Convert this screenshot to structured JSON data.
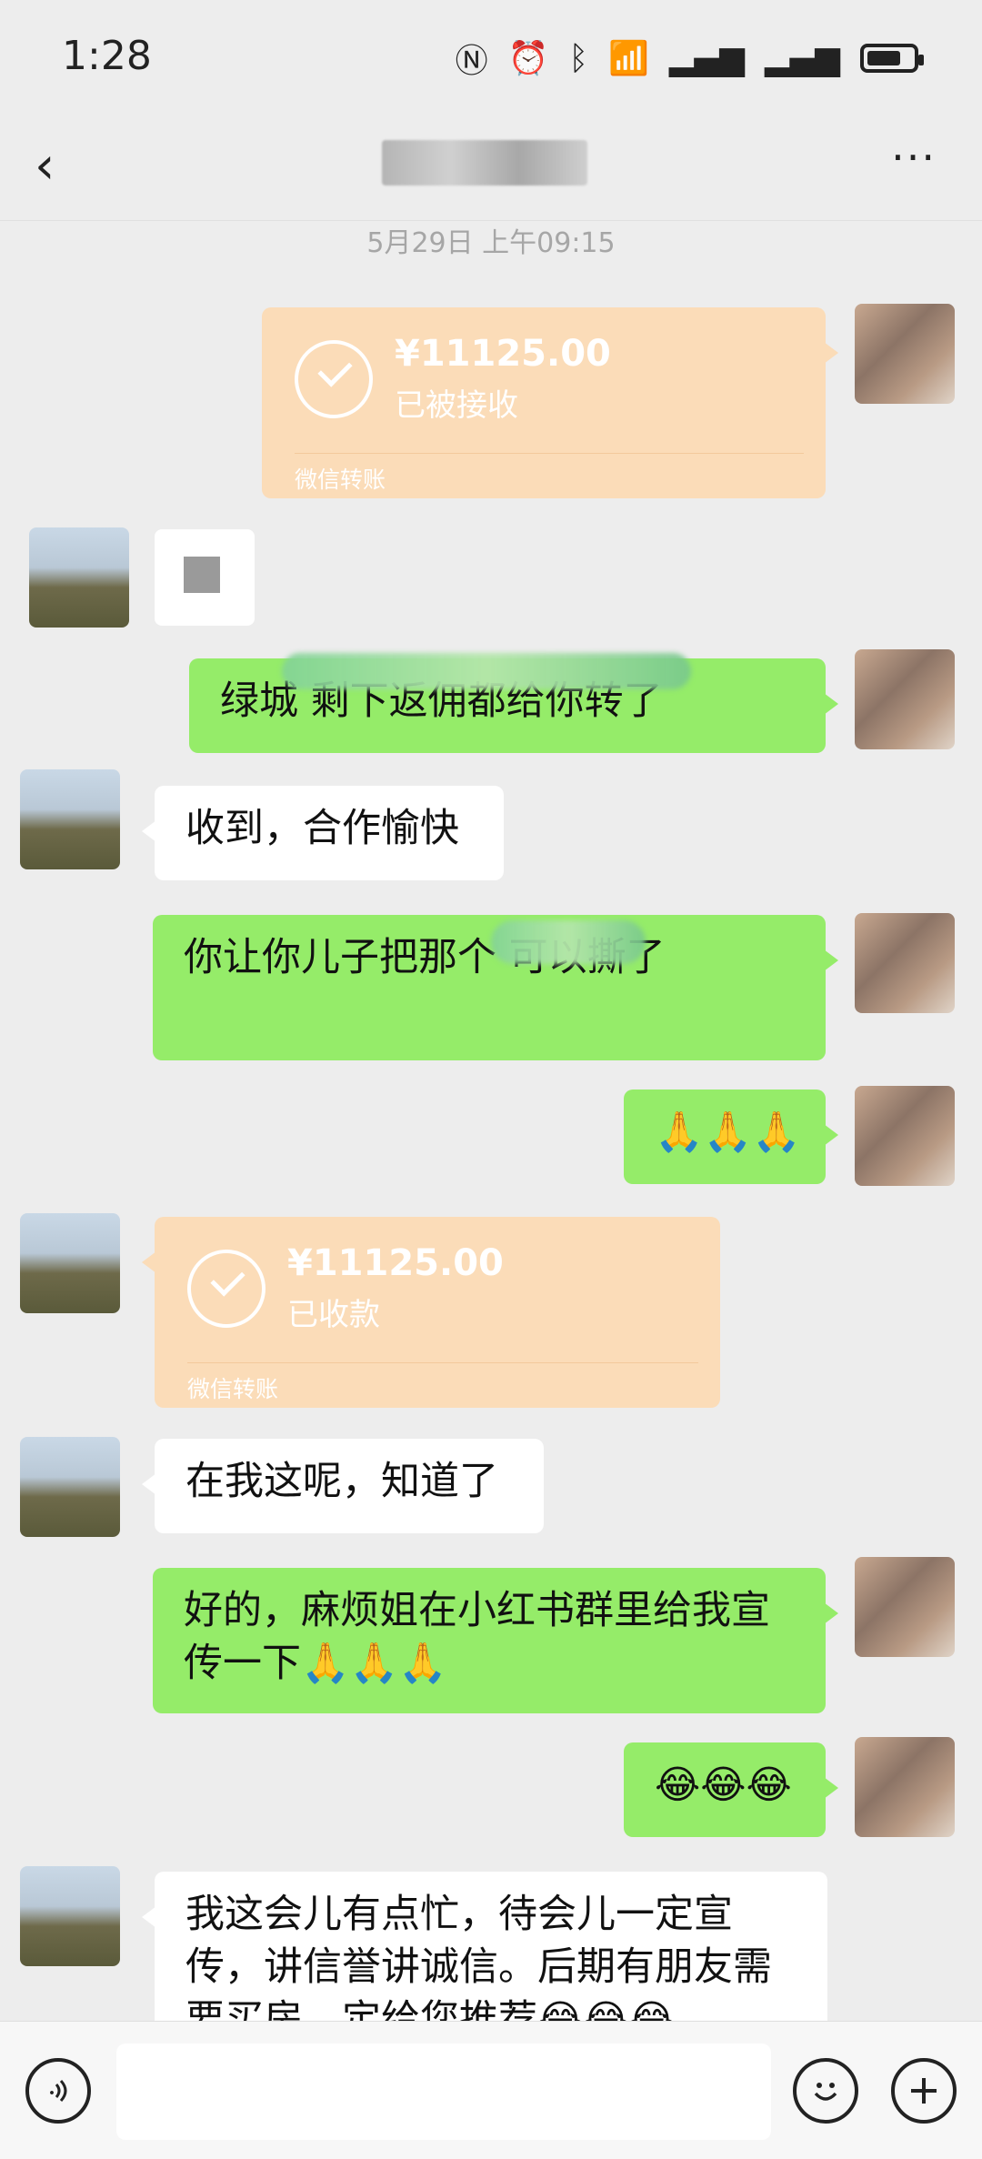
{
  "status_bar": {
    "time": "1:28"
  },
  "header": {
    "title": "",
    "back_icon": "chevron-left-icon",
    "more_label": "···"
  },
  "chat": {
    "timestamp": "5月29日 上午09:15",
    "messages": [
      {
        "side": "right",
        "type": "transfer",
        "amount": "¥11125.00",
        "status": "已被接收",
        "label": "微信转账"
      },
      {
        "side": "left",
        "type": "image"
      },
      {
        "side": "right",
        "type": "text",
        "text": "绿城      剩下返佣都给你转了"
      },
      {
        "side": "left",
        "type": "text",
        "text": "收到，合作愉快"
      },
      {
        "side": "right",
        "type": "text",
        "text": "你让你儿子把那个       可以撕了"
      },
      {
        "side": "right",
        "type": "text",
        "text": "🙏🙏🙏"
      },
      {
        "side": "left",
        "type": "transfer",
        "amount": "¥11125.00",
        "status": "已收款",
        "label": "微信转账"
      },
      {
        "side": "left",
        "type": "text",
        "text": "在我这呢，知道了"
      },
      {
        "side": "right",
        "type": "text",
        "text": "好的，麻烦姐在小红书群里给我宣传一下🙏🙏🙏"
      },
      {
        "side": "right",
        "type": "text",
        "text": "😂😂😂"
      },
      {
        "side": "left",
        "type": "text",
        "text": "我这会儿有点忙，待会儿一定宣传，讲信誉讲诚信。后期有朋友需要买房，定给您推荐😂😂😂"
      }
    ]
  },
  "input_bar": {
    "voice_icon": "voice-icon",
    "emoji_icon": "emoji-icon",
    "plus_icon": "plus-icon",
    "placeholder": ""
  },
  "colors": {
    "background": "#ededed",
    "green_bubble": "#95ec69",
    "transfer_bubble": "#fbdcb8"
  }
}
